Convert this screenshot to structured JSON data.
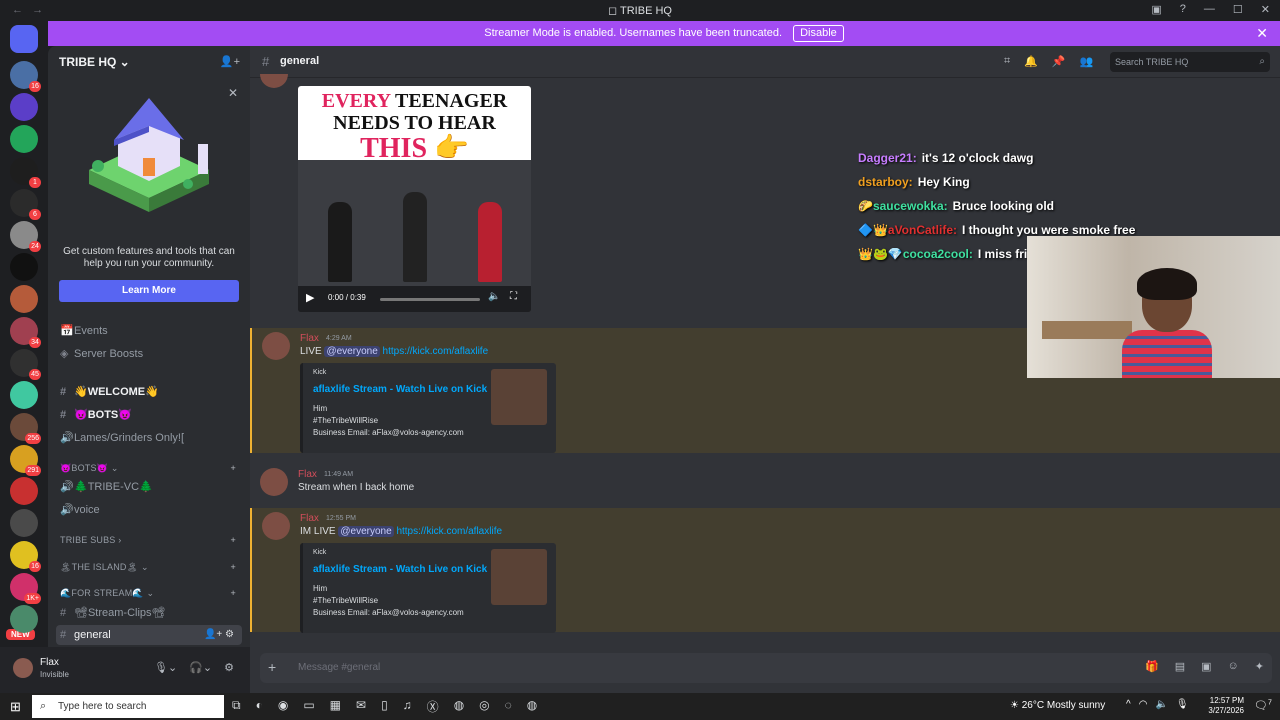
{
  "window": {
    "title": "TRIBE HQ",
    "back": "←",
    "forward": "→",
    "controls": [
      "▣",
      "?",
      "—",
      "☐",
      "✕"
    ]
  },
  "banner": {
    "text": "Streamer Mode is enabled. Usernames have been truncated.",
    "button": "Disable",
    "close": "✕"
  },
  "rail": {
    "servers": [
      {
        "badge": "",
        "color": "#5865f2",
        "icon": "discord-home-icon"
      },
      {
        "badge": "16",
        "color": "#4a6fa5",
        "icon": "server-icon"
      },
      {
        "badge": "",
        "color": "#5b3ec8",
        "icon": "server-icon"
      },
      {
        "badge": "",
        "color": "#23a55a",
        "icon": "server-icon"
      },
      {
        "badge": "1",
        "color": "#1e1e1e",
        "icon": "server-icon"
      },
      {
        "badge": "6",
        "color": "#2b2b2b",
        "icon": "server-icon"
      },
      {
        "badge": "24",
        "color": "#8a8a8a",
        "icon": "server-icon"
      },
      {
        "badge": "",
        "color": "#111111",
        "icon": "server-icon"
      },
      {
        "badge": "",
        "color": "#b55b3a",
        "icon": "server-icon"
      },
      {
        "badge": "34",
        "color": "#a04050",
        "icon": "server-icon"
      },
      {
        "badge": "45",
        "color": "#303030",
        "icon": "server-icon"
      },
      {
        "badge": "",
        "color": "#40c8a0",
        "icon": "server-icon"
      },
      {
        "badge": "256",
        "color": "#6b4a3a",
        "icon": "server-icon"
      },
      {
        "badge": "291",
        "color": "#d8a020",
        "icon": "server-icon"
      },
      {
        "badge": "",
        "color": "#c83030",
        "icon": "server-icon"
      },
      {
        "badge": "",
        "color": "#4a4a4a",
        "icon": "server-icon"
      },
      {
        "badge": "16",
        "color": "#e0c020",
        "icon": "server-icon"
      },
      {
        "badge": "1K+",
        "color": "#d0306a",
        "icon": "server-icon"
      },
      {
        "badge": "",
        "color": "#4a8a6a",
        "icon": "server-icon"
      }
    ],
    "new_label": "NEW"
  },
  "sidebar": {
    "server_name": "TRIBE HQ",
    "promo": {
      "text": "Get custom features and tools that can help you run your community.",
      "button": "Learn More"
    },
    "channels": [
      {
        "icon": "📅",
        "label": "Events",
        "style": "plain"
      },
      {
        "icon": "◈",
        "label": "Server Boosts",
        "style": "plain"
      },
      {
        "icon": "#",
        "label": "👋WELCOME👋",
        "style": "bold"
      },
      {
        "icon": "#",
        "label": "😈BOTS😈",
        "style": "bold"
      },
      {
        "icon": "🔊",
        "label": "Lames/Grinders Only![",
        "style": "plain"
      },
      {
        "icon": "",
        "label": "😈BOTS😈 ⌄",
        "style": "cat"
      },
      {
        "icon": "🔊",
        "label": "🌲TRIBE-VC🌲",
        "style": "plain"
      },
      {
        "icon": "🔊",
        "label": "voice",
        "style": "plain"
      },
      {
        "icon": "",
        "label": "TRIBE SUBS ›",
        "style": "cat"
      },
      {
        "icon": "",
        "label": "🏝THE ISLAND🏝 ⌄",
        "style": "cat"
      },
      {
        "icon": "",
        "label": "🌊FOR STREAM🌊 ⌄",
        "style": "cat"
      },
      {
        "icon": "#",
        "label": "📽Stream-Clips📽",
        "style": "plain"
      },
      {
        "icon": "#",
        "label": "general",
        "style": "sel"
      }
    ]
  },
  "user": {
    "name": "Flax",
    "status": "Invisible"
  },
  "chat": {
    "channel": "general",
    "search_placeholder": "Search TRIBE HQ",
    "video": {
      "caption_line1_red": "EVERY",
      "caption_line1_rest": " TEENAGER",
      "caption_line2": "NEEDS TO HEAR",
      "caption_line3": "THIS 👉",
      "time": "0:00 / 0:39"
    },
    "messages": [
      {
        "author": "Flax",
        "time": "4:29 AM",
        "prefix": "LIVE ",
        "mention": "@everyone",
        "link": "https://kick.com/aflaxlife",
        "embed": {
          "provider": "Kick",
          "title": "aflaxlife Stream - Watch Live on Kick",
          "desc1": "Him",
          "desc2": "#TheTribeWillRise",
          "desc3": "Business Email: aFlax@volos-agency.com"
        }
      },
      {
        "author": "Flax",
        "time": "11:49 AM",
        "text": "Stream when I back home"
      },
      {
        "author": "Flax",
        "time": "12:55 PM",
        "prefix": "IM LIVE ",
        "mention": "@everyone",
        "link": "https://kick.com/aflaxlife",
        "embed": {
          "provider": "Kick",
          "title": "aflaxlife Stream - Watch Live on Kick",
          "desc1": "Him",
          "desc2": "#TheTribeWillRise",
          "desc3": "Business Email: aFlax@volos-agency.com"
        }
      }
    ],
    "composer_placeholder": "Message #general"
  },
  "stream_chat": [
    {
      "badges": "",
      "name": "Dagger21:",
      "name_color": "#c77dff",
      "text": "it's 12 o'clock dawg"
    },
    {
      "badges": "",
      "name": "dstarboy:",
      "name_color": "#f0a020",
      "text": "Hey King"
    },
    {
      "badges": "🌮",
      "name": "saucewokka:",
      "name_color": "#3fe0a0",
      "text": "Bruce looking old"
    },
    {
      "badges": "🔷👑",
      "name": "aVonCatlife:",
      "name_color": "#e03030",
      "text": "I thought you were smoke free"
    },
    {
      "badges": "👑🐸💎",
      "name": "cocoa2cool:",
      "name_color": "#3fe0a0",
      "text": "I miss fried flax"
    }
  ],
  "taskbar": {
    "search_placeholder": "Type here to search",
    "weather": "26°C  Mostly sunny",
    "time": "12:57 PM",
    "date": "3/27/2026",
    "notification_count": "7"
  }
}
